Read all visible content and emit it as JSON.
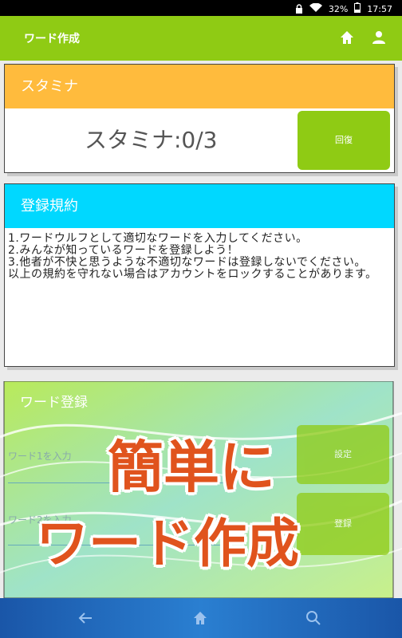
{
  "status": {
    "battery": "32%",
    "time": "17:57"
  },
  "appbar": {
    "title": "ワード作成"
  },
  "stamina": {
    "header": "スタミナ",
    "value_text": "スタミナ:0/3",
    "button_label": "回復"
  },
  "rules": {
    "header": "登録規約",
    "lines": [
      "1.ワードウルフとして適切なワードを入力してください。",
      "2.みんなが知っているワードを登録しよう！",
      "3.他者が不快と思うような不適切なワードは登録しないでください。",
      "以上の規約を守れない場合はアカウントをロックすることがあります。"
    ]
  },
  "word_register": {
    "header": "ワード登録",
    "field1_placeholder": "ワード1を入力",
    "field2_placeholder": "ワード2を入力",
    "button1_label": "設定",
    "button2_label": "登録"
  },
  "promo": {
    "line1": "簡単に",
    "line2": "ワード作成"
  },
  "colors": {
    "accent": "#8fcb14",
    "stamina_head": "#ffbb3d",
    "rules_head": "#00d8ff",
    "promo_text": "#e0531d"
  }
}
